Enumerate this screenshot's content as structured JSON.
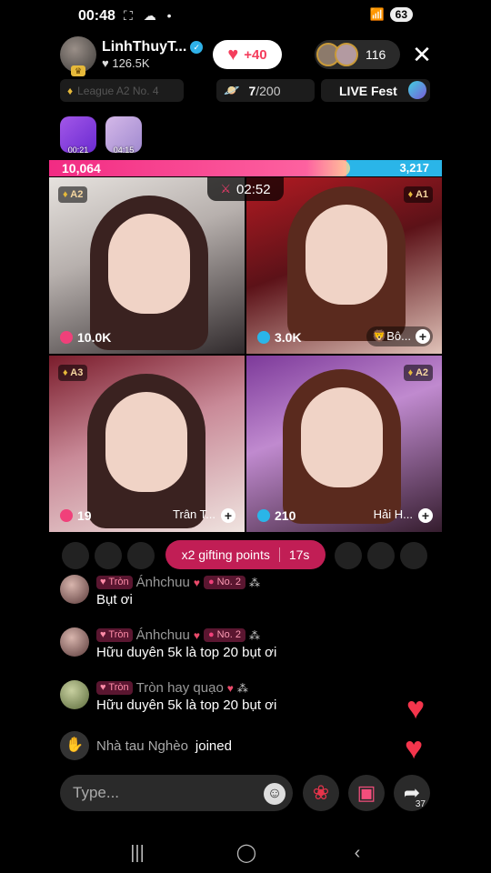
{
  "status_bar": {
    "time": "00:48",
    "battery": "63",
    "left_icons": "⛶ ☁ •",
    "right_icons": "📶"
  },
  "host": {
    "name": "LinhThuyT...",
    "likes": "126.5K",
    "verified_icon": "✓",
    "likes_icon": "♥"
  },
  "like_button": {
    "label": "+40",
    "icon": "heart-icon"
  },
  "viewers": {
    "count": "116"
  },
  "close_icon": "✕",
  "league": {
    "label": "League A2 No. 4",
    "icon": "♦"
  },
  "goal": {
    "current": "7",
    "total": "/200",
    "icon": "🪐"
  },
  "live_fest": {
    "label": "LIVE Fest"
  },
  "gift_timers": [
    {
      "time": "00:21"
    },
    {
      "time": "04:15"
    }
  ],
  "battle": {
    "left_score": "10,064",
    "right_score": "3,217",
    "left_ratio": 0.758,
    "timer": "02:52",
    "vs_icon": "⚔"
  },
  "tiles": [
    {
      "rank": "A2",
      "score": "10.0K",
      "name": ""
    },
    {
      "rank": "A1",
      "score": "3.0K",
      "name": "🦁Bô..."
    },
    {
      "rank": "A3",
      "score": "19",
      "name": "Trân T..."
    },
    {
      "rank": "A2",
      "score": "210",
      "name": "Hải H..."
    }
  ],
  "gifting": {
    "label": "x2 gifting points",
    "countdown": "17s"
  },
  "comments": [
    {
      "tag": "Tròn",
      "user": "Ánhchuu",
      "rank": "No. 2",
      "text": "Bụt ơi"
    },
    {
      "tag": "Tròn",
      "user": "Ánhchuu",
      "rank": "No. 2",
      "text": "Hữu duyên 5k là top 20 bụt ơi"
    },
    {
      "tag": "Tròn",
      "user": "Tròn hay quạo",
      "rank": "",
      "text": "Hữu duyên 5k là top 20 bụt ơi"
    }
  ],
  "joined": {
    "user": "Nhà tau Nghèo",
    "action": "joined"
  },
  "input": {
    "placeholder": "Type..."
  },
  "share": {
    "count": "37"
  },
  "colors": {
    "battle_left": "#f22b83",
    "battle_right": "#2ab5e8",
    "gifting": "#c11e55",
    "heart": "#f4354c"
  }
}
